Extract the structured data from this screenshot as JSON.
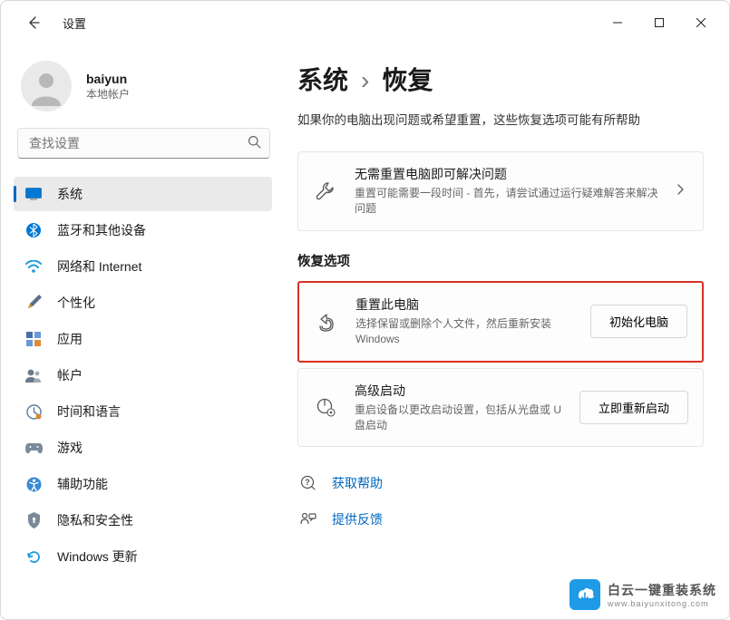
{
  "window": {
    "title": "设置"
  },
  "user": {
    "name": "baiyun",
    "type": "本地帐户"
  },
  "search": {
    "placeholder": "查找设置"
  },
  "nav": {
    "items": [
      {
        "label": "系统"
      },
      {
        "label": "蓝牙和其他设备"
      },
      {
        "label": "网络和 Internet"
      },
      {
        "label": "个性化"
      },
      {
        "label": "应用"
      },
      {
        "label": "帐户"
      },
      {
        "label": "时间和语言"
      },
      {
        "label": "游戏"
      },
      {
        "label": "辅助功能"
      },
      {
        "label": "隐私和安全性"
      },
      {
        "label": "Windows 更新"
      }
    ]
  },
  "breadcrumb": {
    "parent": "系统",
    "current": "恢复"
  },
  "subtitle": "如果你的电脑出现问题或希望重置，这些恢复选项可能有所帮助",
  "troubleshoot": {
    "title": "无需重置电脑即可解决问题",
    "desc": "重置可能需要一段时间 - 首先，请尝试通过运行疑难解答来解决问题"
  },
  "section_header": "恢复选项",
  "reset": {
    "title": "重置此电脑",
    "desc": "选择保留或删除个人文件，然后重新安装 Windows",
    "button": "初始化电脑"
  },
  "advanced": {
    "title": "高级启动",
    "desc": "重启设备以更改启动设置，包括从光盘或 U 盘启动",
    "button": "立即重新启动"
  },
  "links": {
    "help": "获取帮助",
    "feedback": "提供反馈"
  },
  "watermark": {
    "line1": "白云一键重装系统",
    "line2": "www.baiyunxitong.com"
  }
}
